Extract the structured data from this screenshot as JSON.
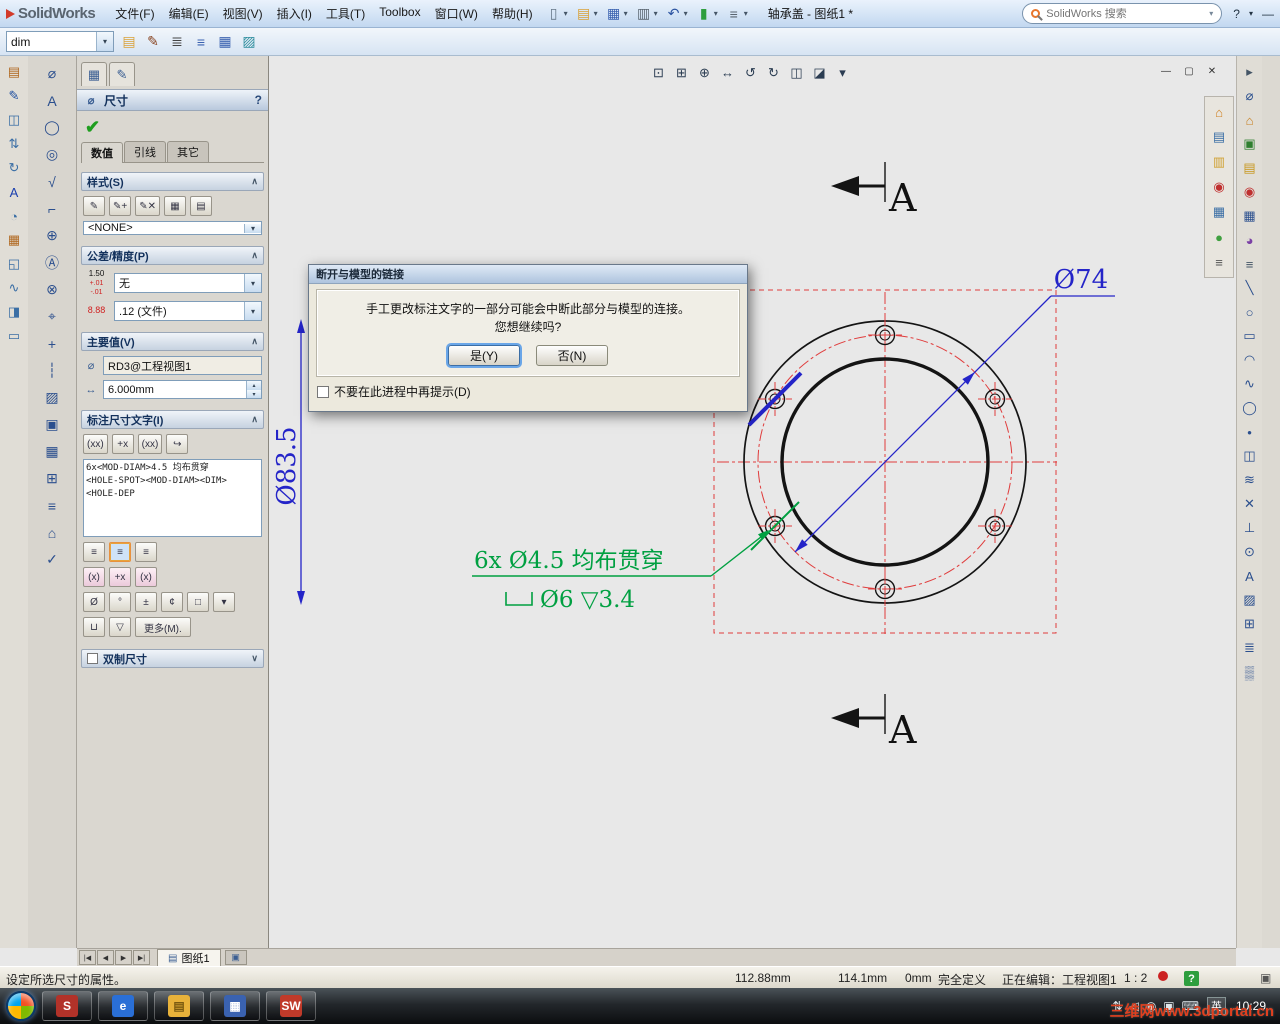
{
  "colors": {
    "accent": "#3a6ea5",
    "dim_blue": "#2424c8",
    "dim_green": "#00a041",
    "centerline_red": "#e03c3c"
  },
  "misc": {
    "caret_down": "▾",
    "caret_up": "▴",
    "chevron_up": "∧",
    "chevron_down": "∨",
    "close": "✕",
    "restore": "▢",
    "minimize": "—",
    "ok_check": "✔",
    "question": "?"
  },
  "titlebar": {
    "logo": "SolidWorks",
    "doc_title": "轴承盖 - 图纸1 *",
    "search_placeholder": "SolidWorks 搜索",
    "menus": [
      "文件(F)",
      "编辑(E)",
      "视图(V)",
      "插入(I)",
      "工具(T)",
      "Toolbox",
      "窗口(W)",
      "帮助(H)"
    ]
  },
  "toolbar2": {
    "style_value": "dim"
  },
  "icons": {
    "titlebar_tools": [
      {
        "name": "new-document-icon",
        "glyph": "▯",
        "color": "#667788"
      },
      {
        "name": "open-document-icon",
        "glyph": "▤",
        "color": "#d9a23a"
      },
      {
        "name": "save-icon",
        "glyph": "▦",
        "color": "#3a62b0"
      },
      {
        "name": "print-icon",
        "glyph": "▥",
        "color": "#5a6570"
      },
      {
        "name": "undo-icon",
        "glyph": "↶",
        "color": "#2a52a0"
      },
      {
        "name": "rebuild-icon",
        "glyph": "▮",
        "color": "#2e9e3e"
      },
      {
        "name": "options-icon",
        "glyph": "≡",
        "color": "#5a6570"
      }
    ],
    "toolbar2_tools": [
      {
        "name": "style-folder-icon",
        "glyph": "▤",
        "color": "#d9a23a"
      },
      {
        "name": "format-painter-icon",
        "glyph": "✎",
        "color": "#88431f"
      },
      {
        "name": "layer-properties-icon",
        "glyph": "≣",
        "color": "#444444"
      },
      {
        "name": "line-format-icon",
        "glyph": "≡",
        "color": "#3a62b0"
      },
      {
        "name": "table-format-icon",
        "glyph": "▦",
        "color": "#3a62b0"
      },
      {
        "name": "color-display-icon",
        "glyph": "▨",
        "color": "#2e8e9e"
      }
    ],
    "pm_tabs": [
      {
        "name": "propertymanager-tab-icon",
        "glyph": "▦"
      },
      {
        "name": "display-pane-tab-icon",
        "glyph": "✎"
      }
    ],
    "left_a": [
      {
        "name": "sheet-format-icon",
        "glyph": "▤",
        "color": "#b06820"
      },
      {
        "name": "edit-sheet-icon",
        "glyph": "✎",
        "color": "#2050a0"
      },
      {
        "name": "model-view-icon",
        "glyph": "◫",
        "color": "#3a6ea5"
      },
      {
        "name": "projected-view-icon",
        "glyph": "⇅",
        "color": "#3a6ea5"
      },
      {
        "name": "auxiliary-view-icon",
        "glyph": "↻",
        "color": "#3a6ea5"
      },
      {
        "name": "annotation-note-icon",
        "glyph": "A",
        "color": "#1a3fae"
      },
      {
        "name": "detail-view-icon",
        "glyph": "◔",
        "color": "#3a6ea5"
      },
      {
        "name": "section-view-icon",
        "glyph": "▦",
        "color": "#b06820"
      },
      {
        "name": "crop-view-icon",
        "glyph": "◱",
        "color": "#3a6ea5"
      },
      {
        "name": "broken-out-view-icon",
        "glyph": "∿",
        "color": "#3a6ea5"
      },
      {
        "name": "break-view-icon",
        "glyph": "◨",
        "color": "#3a6ea5"
      },
      {
        "name": "empty-view-icon",
        "glyph": "▭",
        "color": "#3a6ea5"
      }
    ],
    "left_b": [
      {
        "name": "smart-dimension-icon",
        "glyph": "⌀"
      },
      {
        "name": "note-icon",
        "glyph": "A"
      },
      {
        "name": "balloon-icon",
        "glyph": "◯"
      },
      {
        "name": "auto-balloon-icon",
        "glyph": "◎"
      },
      {
        "name": "surface-finish-icon",
        "glyph": "√"
      },
      {
        "name": "weld-symbol-icon",
        "glyph": "⌐"
      },
      {
        "name": "geometric-tolerance-icon",
        "glyph": "⊕"
      },
      {
        "name": "datum-feature-icon",
        "glyph": "Ⓐ"
      },
      {
        "name": "datum-target-icon",
        "glyph": "⊗"
      },
      {
        "name": "hole-callout-icon",
        "glyph": "⌖"
      },
      {
        "name": "center-mark-icon",
        "glyph": "+"
      },
      {
        "name": "centerline-icon",
        "glyph": "┆"
      },
      {
        "name": "area-hatch-icon",
        "glyph": "▨"
      },
      {
        "name": "block-icon",
        "glyph": "▣"
      },
      {
        "name": "general-table-icon",
        "glyph": "▦"
      },
      {
        "name": "revision-table-icon",
        "glyph": "⊞"
      },
      {
        "name": "bom-table-icon",
        "glyph": "≡"
      },
      {
        "name": "weldment-cutlist-icon",
        "glyph": "⌂"
      },
      {
        "name": "spell-check-icon",
        "glyph": "✓"
      }
    ],
    "right_outer": [
      {
        "name": "collapse-task-pane-icon",
        "glyph": "▸",
        "color": "#445566"
      },
      {
        "name": "smart-dimension-icon",
        "glyph": "⌀",
        "color": "#2b4f8e"
      },
      {
        "name": "home-resources-icon",
        "glyph": "⌂",
        "color": "#c87f1e"
      },
      {
        "name": "design-library-icon",
        "glyph": "▣",
        "color": "#2f7f2f"
      },
      {
        "name": "file-explorer-icon",
        "glyph": "▤",
        "color": "#c8971e"
      },
      {
        "name": "solidworks-search-icon",
        "glyph": "◉",
        "color": "#bf3030"
      },
      {
        "name": "view-palette-icon",
        "glyph": "▦",
        "color": "#2b4f8e"
      },
      {
        "name": "appearances-icon",
        "glyph": "◕",
        "color": "#7a3fa5"
      },
      {
        "name": "custom-properties-icon",
        "glyph": "≡",
        "color": "#445566"
      },
      {
        "name": "line-tool-icon",
        "glyph": "╲",
        "color": "#2b4f8e"
      },
      {
        "name": "circle-tool-icon",
        "glyph": "○",
        "color": "#2b4f8e"
      },
      {
        "name": "rectangle-tool-icon",
        "glyph": "▭",
        "color": "#2b4f8e"
      },
      {
        "name": "arc-tool-icon",
        "glyph": "◠",
        "color": "#2b4f8e"
      },
      {
        "name": "spline-tool-icon",
        "glyph": "∿",
        "color": "#2b4f8e"
      },
      {
        "name": "ellipse-tool-icon",
        "glyph": "◯",
        "color": "#2b4f8e"
      },
      {
        "name": "point-tool-icon",
        "glyph": "•",
        "color": "#2b4f8e"
      },
      {
        "name": "mirror-tool-icon",
        "glyph": "◫",
        "color": "#2b4f8e"
      },
      {
        "name": "offset-tool-icon",
        "glyph": "≋",
        "color": "#2b4f8e"
      },
      {
        "name": "trim-tool-icon",
        "glyph": "✕",
        "color": "#2b4f8e"
      },
      {
        "name": "perpendicular-icon",
        "glyph": "⊥",
        "color": "#2b4f8e"
      },
      {
        "name": "tangent-arc-icon",
        "glyph": "⊙",
        "color": "#2b4f8e"
      },
      {
        "name": "note-tool-icon",
        "glyph": "A",
        "color": "#2b4f8e"
      },
      {
        "name": "hatch-tool-icon",
        "glyph": "▨",
        "color": "#2b4f8e"
      },
      {
        "name": "table-tool-icon",
        "glyph": "⊞",
        "color": "#2b4f8e"
      },
      {
        "name": "layer-tool-icon",
        "glyph": "≣",
        "color": "#2b4f8e"
      },
      {
        "name": "grid-tool-icon",
        "glyph": "▒",
        "color": "#2b4f8e"
      }
    ],
    "task_pane_tabs": [
      {
        "name": "task-pane-resources-icon",
        "glyph": "⌂",
        "color": "#d08020"
      },
      {
        "name": "task-pane-design-library-icon",
        "glyph": "▤",
        "color": "#3a6ea5"
      },
      {
        "name": "task-pane-file-explorer-icon",
        "glyph": "▥",
        "color": "#d0a030"
      },
      {
        "name": "task-pane-search-icon",
        "glyph": "◉",
        "color": "#c03030"
      },
      {
        "name": "task-pane-view-palette-icon",
        "glyph": "▦",
        "color": "#3a6ea5"
      },
      {
        "name": "task-pane-appearances-icon",
        "glyph": "●",
        "color": "#40a040"
      },
      {
        "name": "task-pane-custom-props-icon",
        "glyph": "≡",
        "color": "#555555"
      }
    ],
    "view_toolbar": [
      {
        "name": "zoom-fit-icon",
        "glyph": "⊡"
      },
      {
        "name": "zoom-area-icon",
        "glyph": "⊞"
      },
      {
        "name": "zoom-in-out-icon",
        "glyph": "⊕"
      },
      {
        "name": "pan-icon",
        "glyph": "↔"
      },
      {
        "name": "previous-view-icon",
        "glyph": "↺"
      },
      {
        "name": "refresh-view-icon",
        "glyph": "↻"
      },
      {
        "name": "section-display-icon",
        "glyph": "◫"
      },
      {
        "name": "display-style-icon",
        "glyph": "◪"
      },
      {
        "name": "view-settings-caret-icon",
        "glyph": "▾"
      }
    ],
    "style_buttons": [
      {
        "name": "apply-default-style-button",
        "glyph": "✎"
      },
      {
        "name": "add-style-button",
        "glyph": "✎+"
      },
      {
        "name": "delete-style-button",
        "glyph": "✎✕"
      },
      {
        "name": "save-style-button",
        "glyph": "▦"
      },
      {
        "name": "load-style-button",
        "glyph": "▤"
      }
    ],
    "dimtext_buttons": [
      {
        "name": "dim-value-token-button",
        "glyph": "(xx)"
      },
      {
        "name": "insert-prefix-button",
        "glyph": "+x"
      },
      {
        "name": "dim-text-token-button",
        "glyph": "(xx)"
      },
      {
        "name": "restore-text-button",
        "glyph": "↪"
      }
    ],
    "align_buttons": [
      {
        "name": "align-left-button",
        "glyph": "≡",
        "selected": false
      },
      {
        "name": "align-center-button",
        "glyph": "≡",
        "selected": true
      },
      {
        "name": "align-right-button",
        "glyph": "≡",
        "selected": false
      }
    ],
    "justify_buttons": [
      {
        "name": "justify-top-button",
        "glyph": "(x)"
      },
      {
        "name": "justify-middle-button",
        "glyph": "+x"
      },
      {
        "name": "justify-bottom-button",
        "glyph": "(x)"
      }
    ],
    "tray": [
      {
        "name": "tray-network-icon",
        "glyph": "⇅"
      },
      {
        "name": "tray-volume-icon",
        "glyph": "◁"
      },
      {
        "name": "tray-safety-icon",
        "glyph": "◉"
      },
      {
        "name": "tray-message-icon",
        "glyph": "▣"
      },
      {
        "name": "tray-keyboard-icon",
        "glyph": "⌨"
      }
    ]
  },
  "panel": {
    "title": "尺寸",
    "icon_glyph": "⌀",
    "tabs": [
      "数值",
      "引线",
      "其它"
    ],
    "style": {
      "header": "样式(S)",
      "dropdown": "<NONE>"
    },
    "tolerance": {
      "header": "公差/精度(P)",
      "badge1_top": "1.50",
      "badge1_sub": "+.01 -.01",
      "dropdown1": "无",
      "badge2": "8.88",
      "dropdown2": ".12 (文件)"
    },
    "primary": {
      "header": "主要值(V)",
      "name_value": "RD3@工程视图1",
      "dim_value": "6.000mm"
    },
    "dimtext": {
      "header": "标注尺寸文字(I)",
      "text_line1": "6x<MOD-DIAM>4.5 均布贯穿",
      "text_line2": "<HOLE-SPOT><MOD-DIAM><DIM><HOLE-DEP",
      "symbols": [
        "Ø",
        "°",
        "±",
        "¢",
        "□"
      ],
      "counterbore": "⊔",
      "depth": "▽",
      "more": "更多(M)."
    },
    "dual": {
      "header": "双制尺寸"
    }
  },
  "dialog": {
    "title": "断开与模型的链接",
    "message_line1": "手工更改标注文字的一部分可能会中断此部分与模型的连接。",
    "message_line2": "您想继续吗?",
    "yes_label": "是(Y)",
    "no_label": "否(N)",
    "checkbox_label": "不要在此进程中再提示(D)"
  },
  "drawing": {
    "dia_outer": "Ø83.5",
    "dia_bolt": "Ø74",
    "hole_note_line1": "6x Ø4.5 均布贯穿",
    "hole_note_line2": "Ø6 ▽3.4",
    "section_label": "A"
  },
  "sheetbar": {
    "tab": "图纸1",
    "nav": [
      "|◀",
      "◀",
      "▶",
      "▶|"
    ]
  },
  "statusbar": {
    "hint": "设定所选尺寸的属性。",
    "x": "112.88mm",
    "y": "114.1mm",
    "z": "0mm",
    "state": "完全定义",
    "editing": "正在编辑：工程视图1",
    "scale": "1 : 2"
  },
  "taskbar": {
    "time": "10:29",
    "ime": "英",
    "watermark": "三维网www.3dportal.cn",
    "apps": [
      {
        "name": "taskbar-solidworks-dm-icon",
        "label": "S",
        "bg": "#b23229",
        "fg": "#ffffff"
      },
      {
        "name": "taskbar-internet-explorer-icon",
        "label": "e",
        "bg": "#2a6fd6",
        "fg": "#ffffff"
      },
      {
        "name": "taskbar-explorer-folder-icon",
        "label": "▤",
        "bg": "#e8b23a",
        "fg": "#7a5a10"
      },
      {
        "name": "taskbar-calculator-icon",
        "label": "▦",
        "bg": "#3a62b0",
        "fg": "#ffffff"
      },
      {
        "name": "taskbar-solidworks-icon",
        "label": "SW",
        "bg": "#c03a2a",
        "fg": "#ffffff"
      }
    ]
  }
}
